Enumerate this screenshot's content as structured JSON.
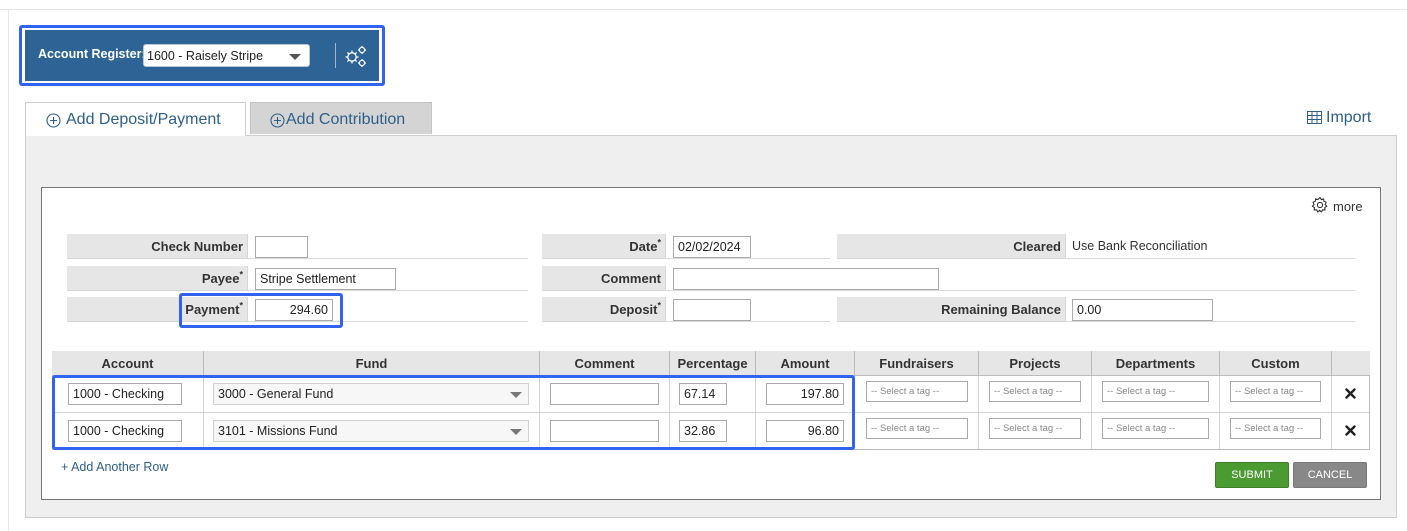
{
  "register": {
    "label": "Account Register:",
    "selected": "1600 - Raisely Stripe",
    "settings_icon": "gears-icon"
  },
  "tabs": [
    {
      "label": "Add Deposit/Payment",
      "icon": "circle-plus-icon",
      "active": true
    },
    {
      "label": "Add Contribution",
      "icon": "circle-plus-icon",
      "active": false
    }
  ],
  "import_label": "Import",
  "more_label": "more",
  "fields": {
    "check_number": {
      "label": "Check Number",
      "value": ""
    },
    "payee": {
      "label": "Payee",
      "value": "Stripe Settlement"
    },
    "payment": {
      "label": "Payment",
      "value": "294.60"
    },
    "date": {
      "label": "Date",
      "value": "02/02/2024"
    },
    "comment": {
      "label": "Comment",
      "value": ""
    },
    "deposit": {
      "label": "Deposit",
      "value": ""
    },
    "cleared": {
      "label": "Cleared",
      "value": "Use Bank Reconciliation"
    },
    "remaining_balance": {
      "label": "Remaining Balance",
      "value": "0.00"
    }
  },
  "grid": {
    "columns": [
      "Account",
      "Fund",
      "Comment",
      "Percentage",
      "Amount",
      "Fundraisers",
      "Projects",
      "Departments",
      "Custom"
    ],
    "rows": [
      {
        "account": "1000 - Checking",
        "fund": "3000 - General Fund",
        "comment": "",
        "percentage": "67.14",
        "amount": "197.80",
        "fundraisers": "-- Select a tag --",
        "projects": "-- Select a tag --",
        "departments": "-- Select a tag --",
        "custom": "-- Select a tag --"
      },
      {
        "account": "1000 - Checking",
        "fund": "3101 - Missions Fund",
        "comment": "",
        "percentage": "32.86",
        "amount": "96.80",
        "fundraisers": "-- Select a tag --",
        "projects": "-- Select a tag --",
        "departments": "-- Select a tag --",
        "custom": "-- Select a tag --"
      }
    ]
  },
  "add_row_label": "+ Add Another Row",
  "buttons": {
    "submit": "SUBMIT",
    "cancel": "CANCEL"
  },
  "colors": {
    "register_bar": "#2d6395",
    "highlight": "#2f63f0",
    "submit": "#4b9a32",
    "link": "#2d5f8a"
  }
}
